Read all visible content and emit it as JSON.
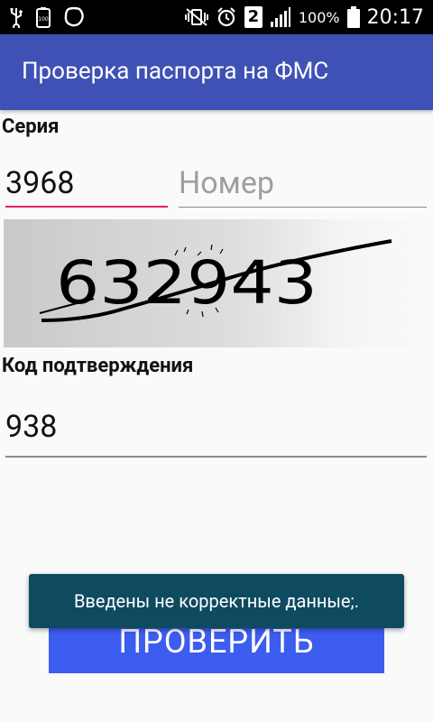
{
  "status_bar": {
    "battery_percent": "100%",
    "time": "20:17",
    "sim_badge": "2",
    "icons": [
      "usb-icon",
      "battery-saver-icon",
      "shape-icon",
      "vibrate-mute-icon",
      "alarm-icon",
      "sim-2-icon",
      "signal-icon",
      "battery-icon"
    ]
  },
  "app_bar": {
    "title": "Проверка паспорта на ФМС"
  },
  "form": {
    "series_label": "Серия",
    "series_value": "3968",
    "number_placeholder": "Номер",
    "captcha_text": "632943",
    "code_label": "Код подтверждения",
    "code_value": "938"
  },
  "button": {
    "label": "ПРОВЕРИТЬ"
  },
  "toast": {
    "message": "Введены не корректные данные;."
  },
  "colors": {
    "primary": "#3f51b5",
    "accent": "#e91e63",
    "button": "#3d5cf0",
    "toast": "#0e4a60"
  }
}
